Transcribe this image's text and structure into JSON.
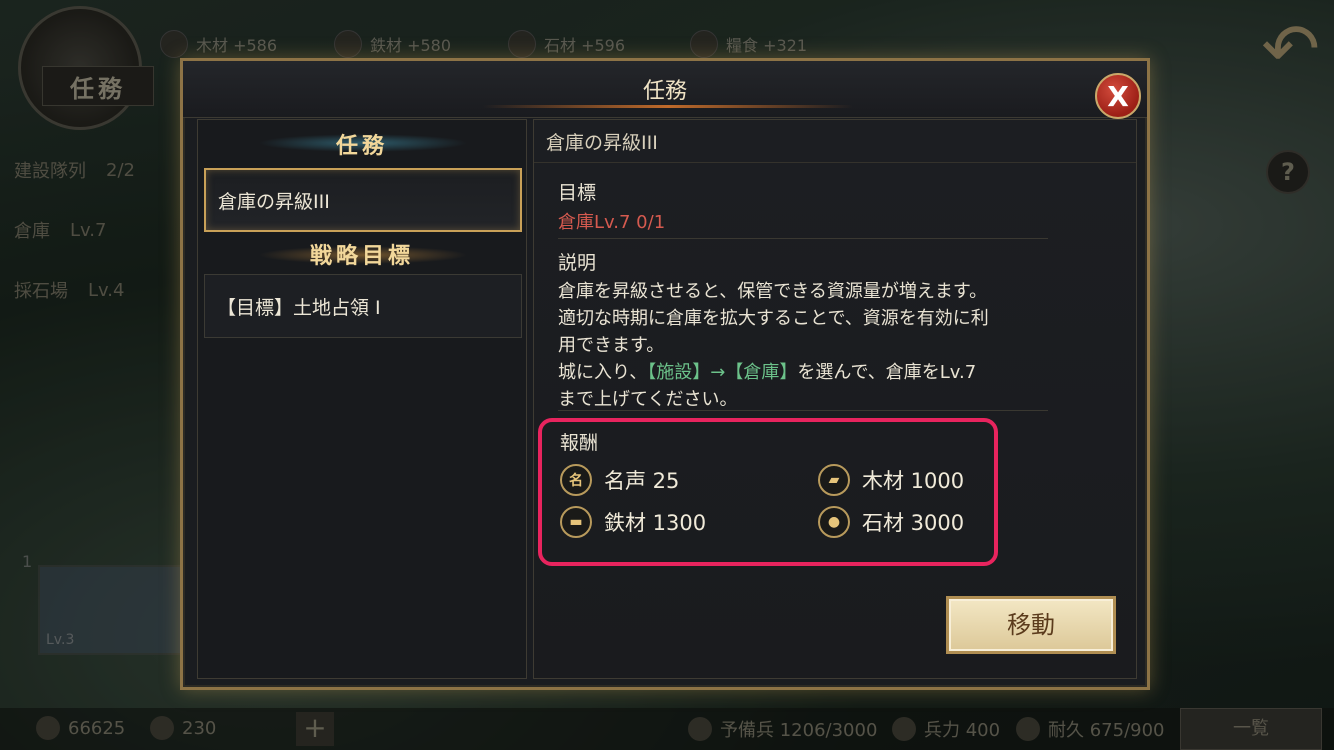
{
  "background": {
    "task_badge_label": "任務",
    "resources": [
      {
        "icon": "wood-icon",
        "text": "木材 +586"
      },
      {
        "icon": "iron-icon",
        "text": "鉄材 +580"
      },
      {
        "icon": "stone-icon",
        "text": "石材 +596"
      },
      {
        "icon": "food-icon",
        "text": "糧食 +321"
      }
    ],
    "side_rows": [
      {
        "name": "建設隊列",
        "value": "2/2"
      },
      {
        "name": "倉庫",
        "value": "Lv.7"
      },
      {
        "name": "採石場",
        "value": "Lv.4"
      }
    ],
    "help_label": "?",
    "hero": {
      "number": "1",
      "level": "Lv.3"
    },
    "bottom": {
      "gold": "66625",
      "gem": "230",
      "plus": "+",
      "reserve": "予備兵 1206/3000",
      "troops": "兵力 400",
      "durability": "耐久 675/900",
      "list_button": "一覧"
    }
  },
  "dialog": {
    "title": "任務",
    "close_label": "X",
    "left": {
      "section1": "任務",
      "quest_selected": "倉庫の昇級III",
      "section2": "戦略目標",
      "strategy_item": "【目標】土地占領 I"
    },
    "right": {
      "title": "倉庫の昇級III",
      "objective_label": "目標",
      "objective_text": "倉庫Lv.7  0/1",
      "description_label": "説明",
      "desc_line1": "倉庫を昇級させると、保管できる資源量が増えます。",
      "desc_line2": "適切な時期に倉庫を拡大することで、資源を有効に利",
      "desc_line3": "用できます。",
      "desc_line4_a": "城に入り、",
      "desc_line4_b": "【施設】→【倉庫】",
      "desc_line4_c": "を選んで、倉庫をLv.7",
      "desc_line5": "まで上げてください。",
      "rewards_label": "報酬",
      "rewards": [
        {
          "icon": "fame-icon",
          "glyph": "名",
          "text": "名声 25"
        },
        {
          "icon": "wood-icon",
          "glyph": "",
          "text": "木材 1000"
        },
        {
          "icon": "iron-icon",
          "glyph": "",
          "text": "鉄材 1300"
        },
        {
          "icon": "stone-icon",
          "glyph": "",
          "text": "石材 3000"
        }
      ],
      "move_button": "移動"
    }
  },
  "colors": {
    "highlight_border": "#e8245e",
    "objective_red": "#d55a4f",
    "link_green": "#6cc28a",
    "gold_border": "#c9a158"
  }
}
